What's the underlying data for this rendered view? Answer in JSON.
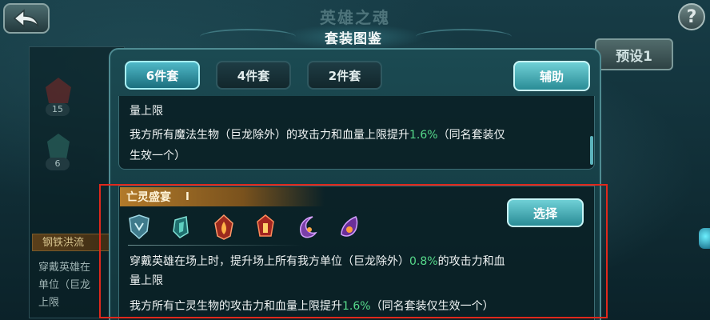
{
  "window": {
    "title": "英雄之魂",
    "help": "?"
  },
  "background": {
    "slot_counts": [
      "15",
      "6"
    ],
    "strip_label": "钢铁洪流",
    "text_lines": [
      "穿戴英雄在",
      "单位（巨龙",
      "上限"
    ],
    "preset_label": "预设1"
  },
  "modal": {
    "title": "套装图鉴",
    "tabs": [
      {
        "label": "6件套",
        "active": true
      },
      {
        "label": "4件套",
        "active": false
      },
      {
        "label": "2件套",
        "active": false
      }
    ],
    "assist_label": "辅助",
    "top_card": {
      "line1": "量上限",
      "line2_before": "我方所有魔法生物（巨龙除外）的攻击力和血量上限提升",
      "line2_highlight": "1.6%",
      "line2_after": "（同名套装仅",
      "line3": "生效一个）"
    },
    "set": {
      "name": "亡灵盛宴",
      "mark": "Ⅰ",
      "select_label": "选择",
      "item_icons": [
        "shield-rune-icon",
        "green-crystal-icon",
        "red-flame-emblem-icon",
        "red-totem-icon",
        "purple-moon-icon",
        "purple-fang-icon"
      ],
      "line1_before": "穿戴英雄在场上时，提升场上所有我方单位（巨龙除外）",
      "line1_highlight": "0.8%",
      "line1_after": "的攻击力和血",
      "line2": "量上限",
      "line3_before": "我方所有亡灵生物的攻击力和血量上限提升",
      "line3_highlight": "1.6%",
      "line3_after": "（同名套装仅生效一个）"
    }
  },
  "colors": {
    "highlight_green": "#56d98a",
    "annotation_red": "#e0281c",
    "accent_teal": "#4fb8c7"
  }
}
